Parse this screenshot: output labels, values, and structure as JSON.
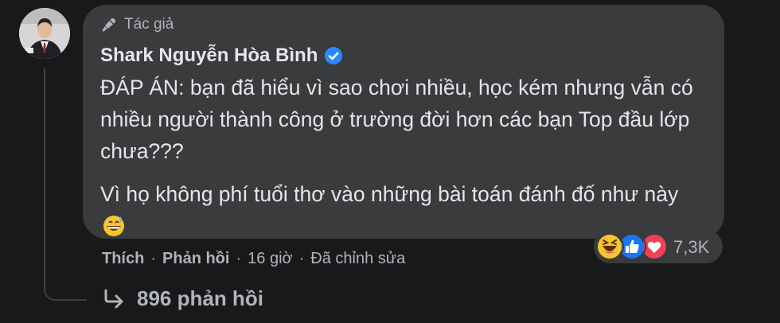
{
  "comment": {
    "badge_label": "Tác giả",
    "author_name": "Shark Nguyễn Hòa Bình",
    "paragraph_1": "ĐÁP ÁN: bạn đã hiểu vì sao chơi nhiều, học kém nhưng vẫn có nhiều người thành công ở trường đời hơn các bạn Top đầu lớp chưa???",
    "paragraph_2": "Vì họ không phí tuổi thơ vào những bài toán đánh đố như này",
    "emoji": "grinning-sweat-emoji"
  },
  "reactions": {
    "icons": [
      "haha-icon",
      "like-icon",
      "love-icon"
    ],
    "count": "7,3K"
  },
  "actions": {
    "like_label": "Thích",
    "reply_label": "Phản hồi",
    "time": "16 giờ",
    "edited_label": "Đã chỉnh sửa",
    "separator": "·"
  },
  "replies": {
    "label": "896 phản hồi",
    "icon": "reply-arrow-icon"
  },
  "colors": {
    "background": "#18191a",
    "bubble": "#3a3b3c",
    "text": "#e4e6eb",
    "secondary": "#b0b3b8",
    "verified": "#2d88ff"
  }
}
